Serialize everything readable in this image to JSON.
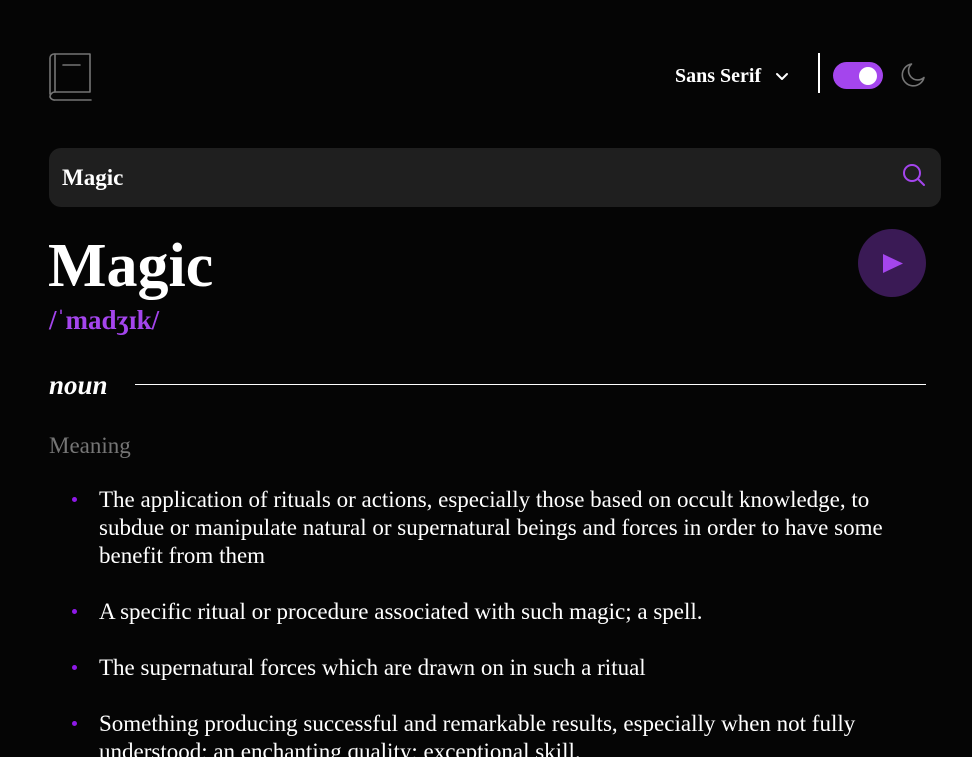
{
  "header": {
    "logo_icon": "book-icon",
    "font_selector": {
      "selected": "Sans Serif",
      "icon": "chevron-down-icon"
    },
    "theme_toggle": {
      "state": "on",
      "icon": "moon-icon"
    }
  },
  "search": {
    "value": "Magic",
    "icon": "search-icon"
  },
  "entry": {
    "word": "Magic",
    "phonetic": "/ˈmadʒɪk/",
    "play_icon": "play-icon",
    "part_of_speech": "noun",
    "meaning_label": "Meaning",
    "definitions": [
      {
        "text": "The application of rituals or actions, especially those based on occult knowledge, to subdue or manipulate natural or supernatural beings and forces in order to have some benefit from them"
      },
      {
        "text": "A specific ritual or procedure associated with such magic; a spell."
      },
      {
        "text": "The supernatural forces which are drawn on in such a ritual"
      },
      {
        "text": "Something producing successful and remarkable results, especially when not fully understood; an enchanting quality; exceptional skill."
      }
    ]
  },
  "colors": {
    "accent": "#a445ed",
    "background": "#050505",
    "search_bg": "#1f1f1f",
    "muted": "#757575",
    "play_bg": "#3a1a55"
  }
}
